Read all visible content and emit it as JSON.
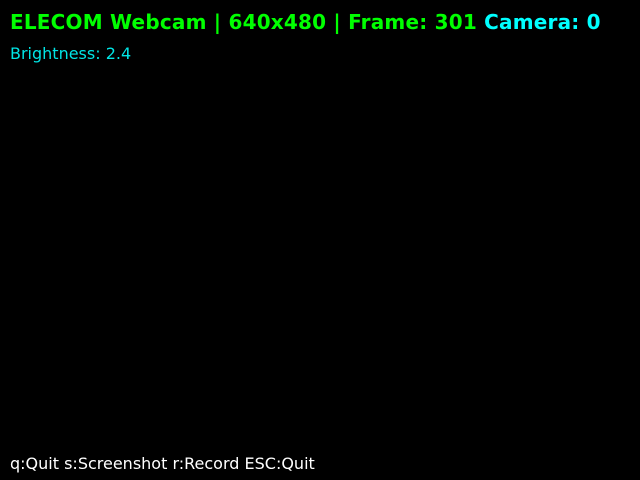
{
  "overlay": {
    "title": "ELECOM Webcam | 640x480 | Frame: 301",
    "camera": "Camera: 0",
    "brightness": "Brightness: 2.4",
    "help": "q:Quit s:Screenshot r:Record ESC:Quit"
  },
  "colors": {
    "title": "#00ff00",
    "camera": "#00ffff",
    "brightness": "#00e5e5",
    "help": "#ffffff",
    "background": "#000000"
  }
}
